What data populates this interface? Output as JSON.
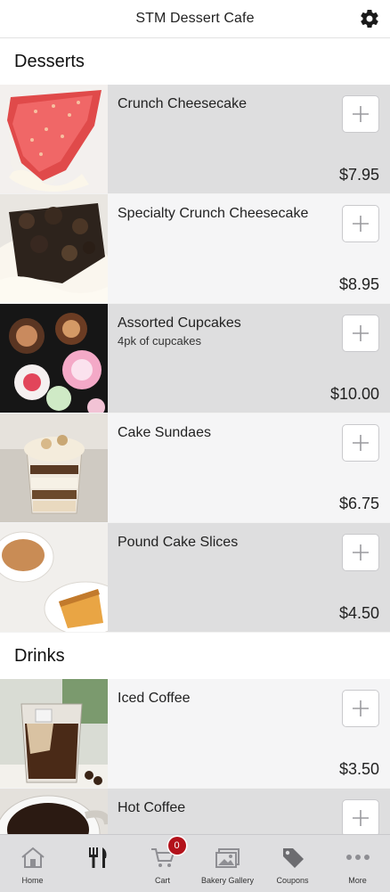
{
  "header": {
    "title": "STM Dessert Cafe",
    "settings_icon": "gear-icon"
  },
  "sections": [
    {
      "title": "Desserts",
      "items": [
        {
          "name": "Crunch Cheesecake",
          "description": "",
          "price": "$7.95"
        },
        {
          "name": "Specialty Crunch Cheesecake",
          "description": "",
          "price": "$8.95"
        },
        {
          "name": "Assorted Cupcakes",
          "description": "4pk of cupcakes",
          "price": "$10.00"
        },
        {
          "name": "Cake Sundaes",
          "description": "",
          "price": "$6.75"
        },
        {
          "name": "Pound Cake Slices",
          "description": "",
          "price": "$4.50"
        }
      ]
    },
    {
      "title": "Drinks",
      "items": [
        {
          "name": "Iced Coffee",
          "description": "",
          "price": "$3.50"
        },
        {
          "name": "Hot Coffee",
          "description": "",
          "price": ""
        }
      ]
    }
  ],
  "tabbar": {
    "tabs": [
      {
        "label": "Home",
        "icon": "home-icon"
      },
      {
        "label": "",
        "icon": "utensils-icon"
      },
      {
        "label": "Cart",
        "icon": "cart-icon",
        "badge": "0"
      },
      {
        "label": "Bakery Gallery",
        "icon": "gallery-icon"
      },
      {
        "label": "Coupons",
        "icon": "tag-icon"
      },
      {
        "label": "More",
        "icon": "more-icon"
      }
    ]
  },
  "colors": {
    "badge": "#b3121b",
    "row_dark": "#dededf",
    "row_light": "#f5f5f6",
    "tabbar": "#dedee0"
  }
}
